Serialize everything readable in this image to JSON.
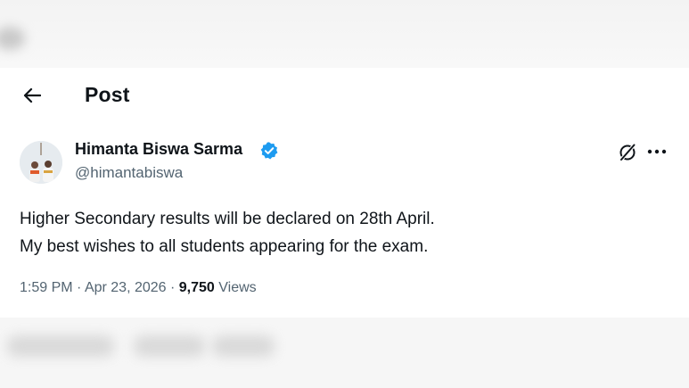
{
  "header": {
    "title": "Post",
    "back_icon": "arrow-left-icon"
  },
  "author": {
    "name": "Himanta Biswa Sarma",
    "handle": "@himantabiswa",
    "verified_icon": "verified-badge-icon",
    "verified_color": "#1d9bf0"
  },
  "actions": {
    "grok_icon": "grok-icon",
    "more_icon": "more-horizontal-icon"
  },
  "tweet": {
    "lines": [
      "Higher Secondary results will be declared on 28th April.",
      "My best wishes to all students appearing for the exam."
    ]
  },
  "meta": {
    "time": "1:59 PM",
    "sep1": " · ",
    "date": "Apr 23, 2026",
    "sep2": " · ",
    "views_count": "9,750",
    "views_label": " Views"
  },
  "colors": {
    "text_primary": "#0f1419",
    "text_secondary": "#536471",
    "accent": "#1d9bf0"
  }
}
